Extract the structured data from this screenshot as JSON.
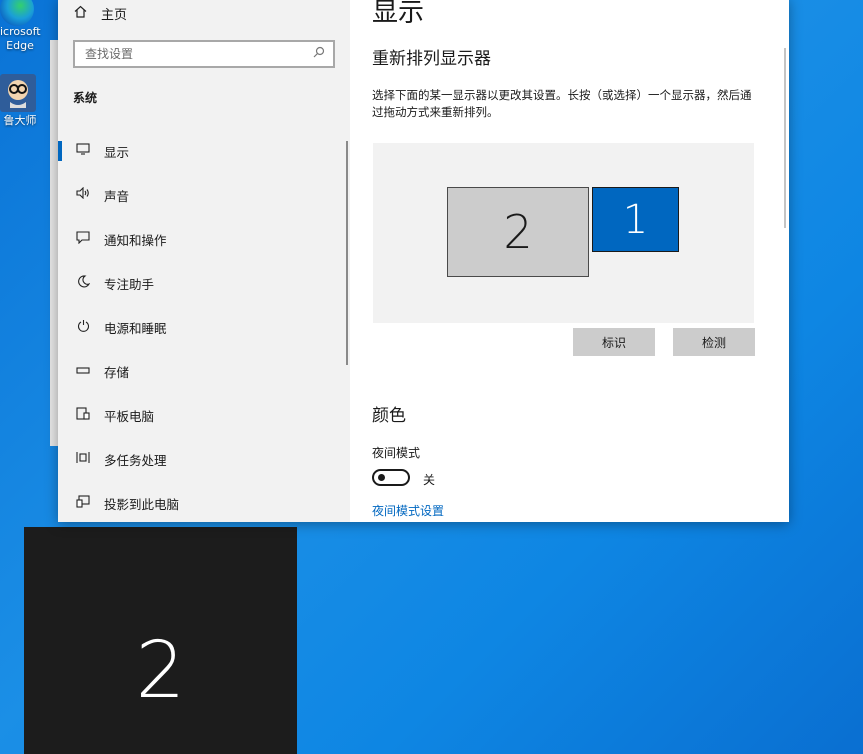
{
  "desktop": {
    "icons": [
      {
        "label_line1": "icrosoft",
        "label_line2": "Edge",
        "icon": "edge-icon"
      },
      {
        "label_line1": "鲁大师",
        "icon": "ludashi-icon"
      }
    ],
    "identify_overlay_number": "2"
  },
  "sidebar": {
    "home_label": "主页",
    "search_placeholder": "查找设置",
    "section_title": "系统",
    "items": [
      {
        "label": "显示",
        "icon": "monitor-icon",
        "active": true
      },
      {
        "label": "声音",
        "icon": "speaker-icon"
      },
      {
        "label": "通知和操作",
        "icon": "notification-icon"
      },
      {
        "label": "专注助手",
        "icon": "moon-icon"
      },
      {
        "label": "电源和睡眠",
        "icon": "power-icon"
      },
      {
        "label": "存储",
        "icon": "storage-icon"
      },
      {
        "label": "平板电脑",
        "icon": "tablet-icon"
      },
      {
        "label": "多任务处理",
        "icon": "multitask-icon"
      },
      {
        "label": "投影到此电脑",
        "icon": "project-icon"
      }
    ]
  },
  "content": {
    "title": "显示",
    "rearrange_heading": "重新排列显示器",
    "description": "选择下面的某一显示器以更改其设置。长按（或选择）一个显示器，然后通过拖动方式来重新排列。",
    "monitors": [
      {
        "number": "2",
        "selected": false
      },
      {
        "number": "1",
        "selected": true
      }
    ],
    "identify_button": "标识",
    "detect_button": "检测",
    "color_heading": "颜色",
    "night_light_label": "夜间模式",
    "night_light_state": "关",
    "night_light_link": "夜间模式设置"
  },
  "colors": {
    "accent": "#0067c0",
    "desktop": "#0a73d6",
    "sidebar_bg": "#f2f2f2"
  }
}
